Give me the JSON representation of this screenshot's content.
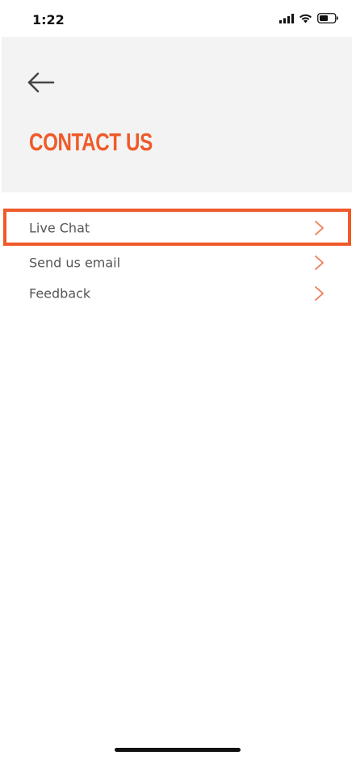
{
  "status_bar": {
    "time": "1:22",
    "icons": [
      "signal-icon",
      "wifi-icon",
      "battery-icon"
    ]
  },
  "header": {
    "back_icon": "arrow-left-icon",
    "title": "CONTACT US"
  },
  "menu": {
    "items": [
      {
        "label": "Live Chat",
        "icon": "chevron-right-icon",
        "highlighted": true
      },
      {
        "label": "Send us email",
        "icon": "chevron-right-icon"
      },
      {
        "label": "Feedback",
        "icon": "chevron-right-icon"
      }
    ]
  },
  "colors": {
    "accent": "#ef5a2a",
    "header_bg": "#f3f3f3",
    "text": "#555555"
  }
}
